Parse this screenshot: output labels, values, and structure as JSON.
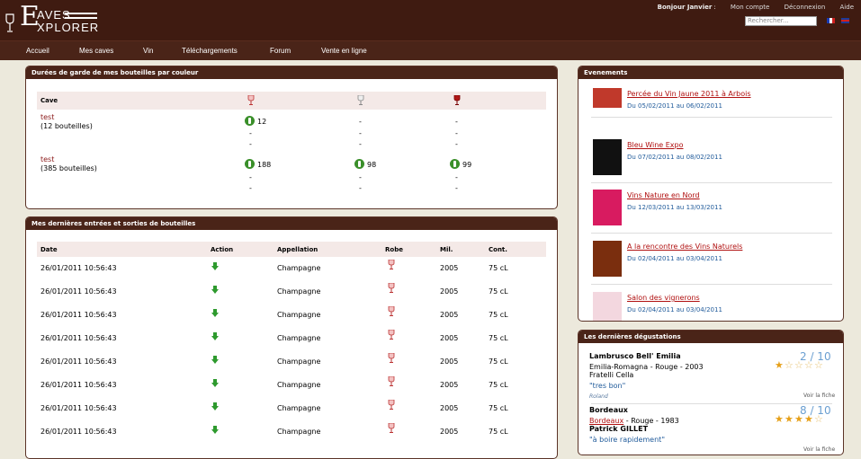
{
  "brand": {
    "word1": "AVES",
    "word2": "XPLORER",
    "initial": "E"
  },
  "topbar": {
    "greeting": "Bonjour Janvier",
    "links": [
      "Mon compte",
      "Déconnexion",
      "Aide"
    ],
    "search_placeholder": "Rechercher..."
  },
  "nav": [
    "Accueil",
    "Mes caves",
    "Vin",
    "Téléchargements",
    "Forum",
    "Vente en ligne"
  ],
  "panel_durees": {
    "title": "Durées de garde de mes bouteilles par couleur",
    "col_cave": "Cave",
    "caves": [
      {
        "name": "test",
        "count": "(12 bouteilles)",
        "vals": [
          "12",
          "-",
          "-"
        ],
        "rest": [
          [
            "-",
            "-",
            "-"
          ],
          [
            "-",
            "-",
            "-"
          ]
        ]
      },
      {
        "name": "test",
        "count": "(385 bouteilles)",
        "vals": [
          "188",
          "98",
          "99"
        ],
        "rest": [
          [
            "-",
            "-",
            "-"
          ],
          [
            "-",
            "-",
            "-"
          ]
        ]
      }
    ]
  },
  "panel_mouvements": {
    "title": "Mes dernières entrées et sorties de bouteilles",
    "headers": [
      "Date",
      "Action",
      "Appellation",
      "Robe",
      "Mil.",
      "Cont."
    ],
    "rows": [
      [
        "26/01/2011 10:56:43",
        "Champagne",
        "2005",
        "75 cL"
      ],
      [
        "26/01/2011 10:56:43",
        "Champagne",
        "2005",
        "75 cL"
      ],
      [
        "26/01/2011 10:56:43",
        "Champagne",
        "2005",
        "75 cL"
      ],
      [
        "26/01/2011 10:56:43",
        "Champagne",
        "2005",
        "75 cL"
      ],
      [
        "26/01/2011 10:56:43",
        "Champagne",
        "2005",
        "75 cL"
      ],
      [
        "26/01/2011 10:56:43",
        "Champagne",
        "2005",
        "75 cL"
      ],
      [
        "26/01/2011 10:56:43",
        "Champagne",
        "2005",
        "75 cL"
      ],
      [
        "26/01/2011 10:56:43",
        "Champagne",
        "2005",
        "75 cL"
      ]
    ]
  },
  "panel_evenements": {
    "title": "Evenements",
    "items": [
      {
        "title": "Percée du Vin Jaune 2011 à Arbois",
        "date": "Du 05/02/2011 au 06/02/2011",
        "thumb_color": "#c0392b"
      },
      {
        "title": "Bleu Wine Expo",
        "date": "Du 07/02/2011 au 08/02/2011",
        "thumb_color": "#111111",
        "thumb_text": "Bleu expo"
      },
      {
        "title": "Vins Nature en Nord",
        "date": "Du 12/03/2011 au 13/03/2011",
        "thumb_color": "#d81b60"
      },
      {
        "title": "A la rencontre des Vins Naturels",
        "date": "Du 02/04/2011 au 03/04/2011",
        "thumb_color": "#7a2e0e"
      },
      {
        "title": "Salon des vignerons",
        "date": "Du 02/04/2011 au 03/04/2011",
        "thumb_color": "#f3d7df"
      }
    ]
  },
  "panel_degustations": {
    "title": "Les dernières dégustations",
    "items": [
      {
        "wine": "Lambrusco Bell' Emilia",
        "region": "Emilia-Romagna - Rouge - 2003",
        "producer": "Fratelli Cella",
        "comment": "\"tres bon\"",
        "author": "Roland",
        "link": "Voir la fiche",
        "score": "2 / 10",
        "stars": 1
      },
      {
        "wine": "Bordeaux",
        "region_link": "Bordeaux",
        "region_rest": " - Rouge - 1983",
        "producer": "Patrick GILLET",
        "comment": "\"à boire rapidement\"",
        "link": "Voir la fiche",
        "score": "8 / 10",
        "stars": 4
      }
    ]
  },
  "colors": {
    "header": "#3f1b11",
    "nav": "#4a2418",
    "accent_red": "#b01010",
    "link_blue": "#1f5a9a"
  }
}
